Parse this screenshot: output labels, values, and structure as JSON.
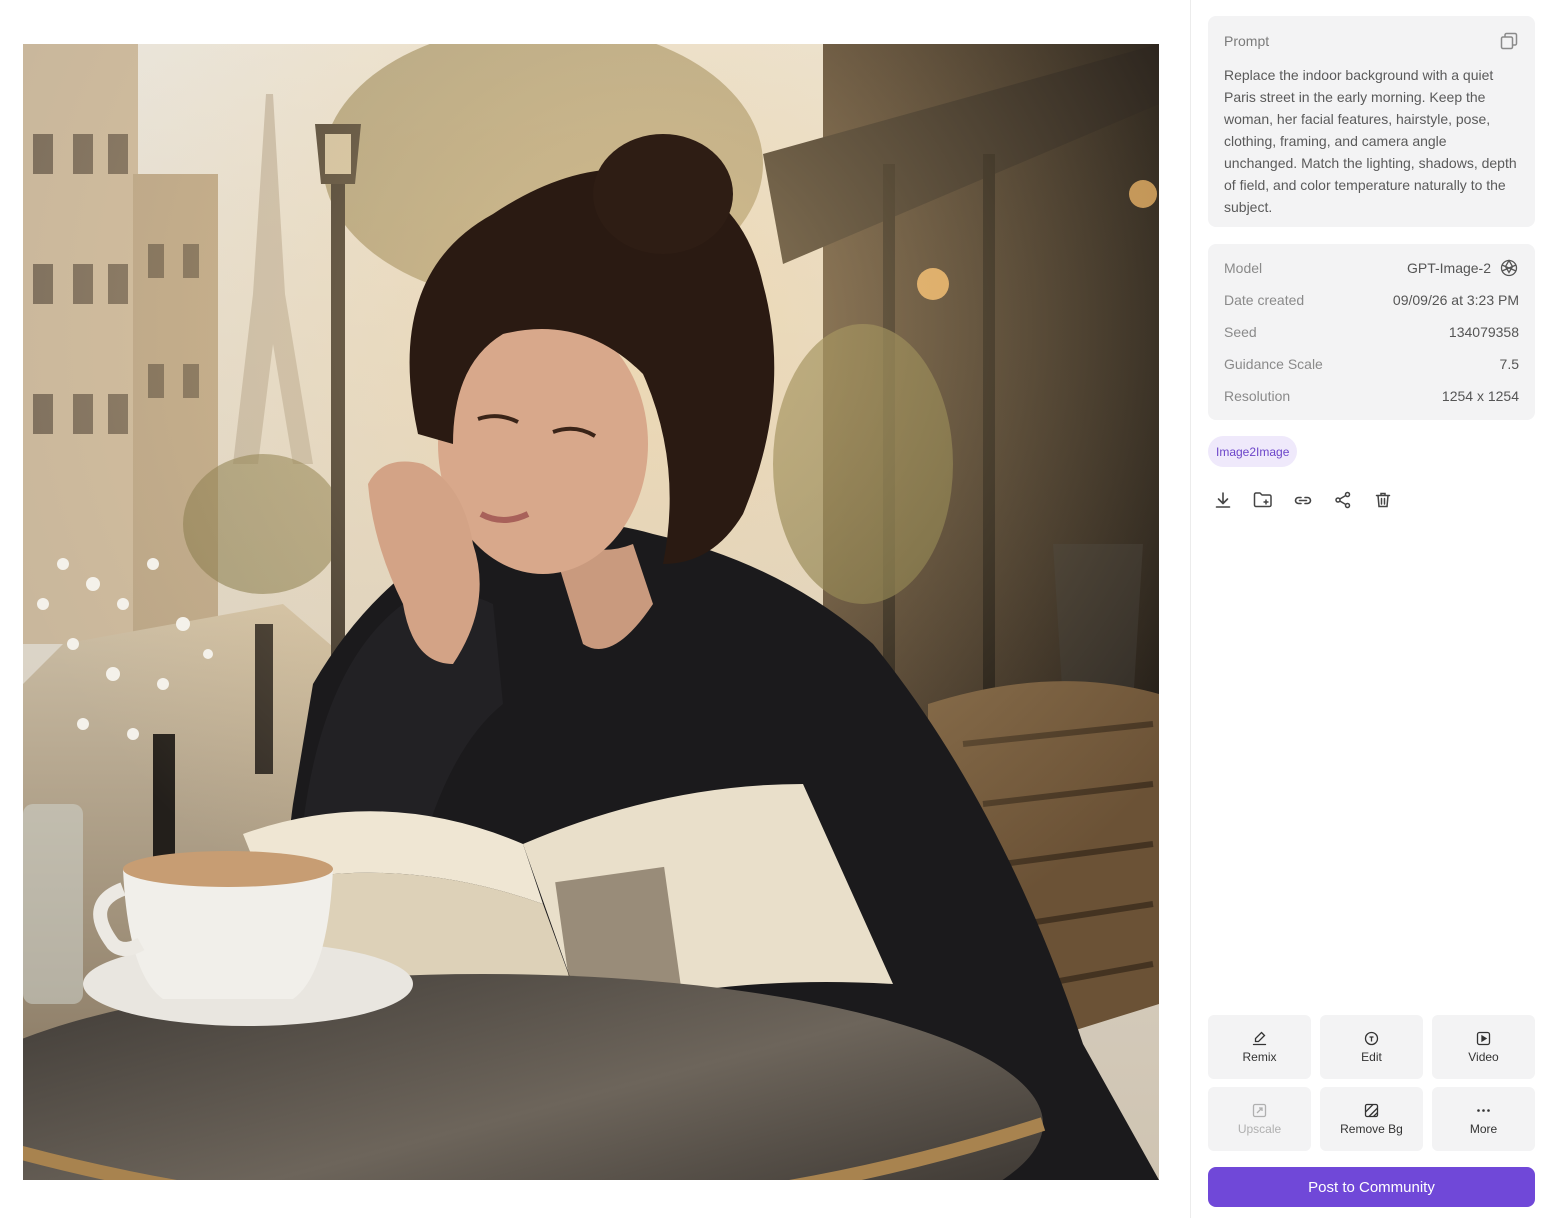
{
  "prompt": {
    "label": "Prompt",
    "text": "Replace the indoor background with a quiet Paris street in the early morning. Keep the woman, her facial features, hairstyle, pose, clothing, framing, and camera angle unchanged. Match the lighting, shadows, depth of field, and color temperature naturally to the subject."
  },
  "details": [
    {
      "label": "Model",
      "value": "GPT-Image-2",
      "icon": "openai-logo-icon"
    },
    {
      "label": "Date created",
      "value": "09/09/26 at 3:23 PM"
    },
    {
      "label": "Seed",
      "value": "134079358"
    },
    {
      "label": "Guidance Scale",
      "value": "7.5"
    },
    {
      "label": "Resolution",
      "value": "1254 x 1254"
    }
  ],
  "tag": "Image2Image",
  "actions": [
    "download-icon",
    "add-to-folder-icon",
    "link-icon",
    "share-icon",
    "trash-icon"
  ],
  "tools": [
    {
      "label": "Remix",
      "icon": "remix-icon",
      "enabled": true
    },
    {
      "label": "Edit",
      "icon": "edit-icon",
      "enabled": true
    },
    {
      "label": "Video",
      "icon": "video-icon",
      "enabled": true
    },
    {
      "label": "Upscale",
      "icon": "upscale-icon",
      "enabled": false
    },
    {
      "label": "Remove Bg",
      "icon": "remove-bg-icon",
      "enabled": true
    },
    {
      "label": "More",
      "icon": "more-icon",
      "enabled": true
    }
  ],
  "post_button": "Post to Community",
  "colors": {
    "accent": "#7048d8",
    "tag_bg": "#efe9fb",
    "tag_text": "#6c45c9",
    "card_bg": "#f3f3f4"
  }
}
